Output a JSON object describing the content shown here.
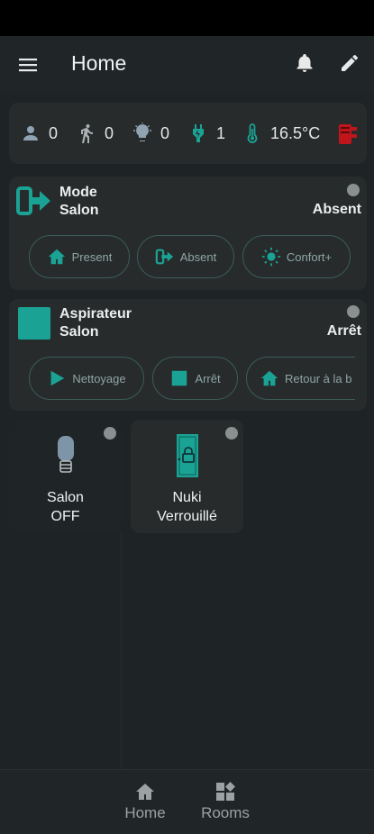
{
  "header": {
    "title": "Home"
  },
  "stats": {
    "persons": "0",
    "motion": "0",
    "lights": "0",
    "plugs": "1",
    "temperature": "16.5°C"
  },
  "mode_tile": {
    "title_line1": "Mode",
    "title_line2": "Salon",
    "state": "Absent",
    "buttons": [
      "Present",
      "Absent",
      "Confort+"
    ]
  },
  "vacuum_tile": {
    "title_line1": "Aspirateur",
    "title_line2": "Salon",
    "state": "Arrêt",
    "buttons": [
      "Nettoyage",
      "Arrêt",
      "Retour à la b"
    ]
  },
  "light_tile": {
    "line1": "Salon",
    "line2": "OFF"
  },
  "lock_tile": {
    "line1": "Nuki",
    "line2": "Verrouillé"
  },
  "nav": {
    "home": "Home",
    "rooms": "Rooms"
  },
  "colors": {
    "accent": "#1aa394",
    "background": "#1d2224",
    "card": "#272b2c",
    "heater": "#c0151a"
  }
}
